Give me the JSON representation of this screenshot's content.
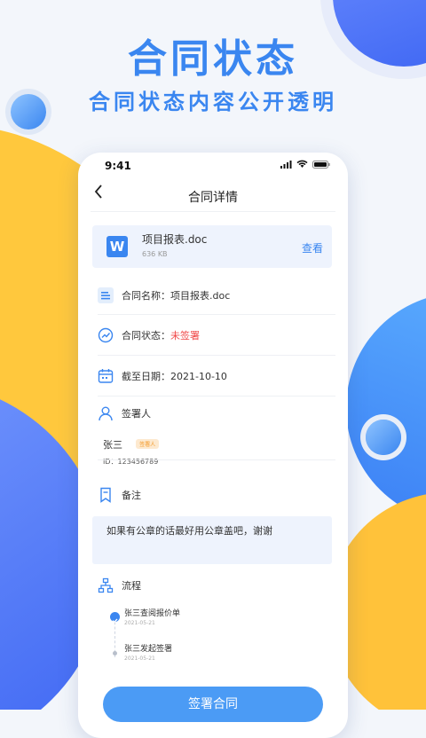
{
  "hero": {
    "title": "合同状态",
    "subtitle": "合同状态内容公开透明"
  },
  "statusbar": {
    "time": "9:41"
  },
  "nav": {
    "title": "合同详情"
  },
  "file": {
    "icon_letter": "W",
    "name": "项目报表.doc",
    "size": "636 KB",
    "view_label": "查看"
  },
  "fields": {
    "name_label": "合同名称：",
    "name_value": "项目报表.doc",
    "status_label": "合同状态：",
    "status_value": "未签署",
    "deadline_label": "截至日期：",
    "deadline_value": "2021-10-10"
  },
  "signer_section": {
    "title": "签署人",
    "name": "张三",
    "badge": "签署人",
    "id": "ID：123456789"
  },
  "remark": {
    "title": "备注",
    "text": "如果有公章的话最好用公章盖吧，谢谢"
  },
  "process": {
    "title": "流程",
    "steps": [
      {
        "text": "张三查阅报价单",
        "date": "2021-05-21"
      },
      {
        "text": "张三发起签署",
        "date": "2021-05-21"
      }
    ]
  },
  "button": {
    "label": "签署合同"
  },
  "colors": {
    "accent": "#3a86f0",
    "danger": "#f04848",
    "warning": "#f39a2a",
    "yellow": "#ffc83d"
  }
}
